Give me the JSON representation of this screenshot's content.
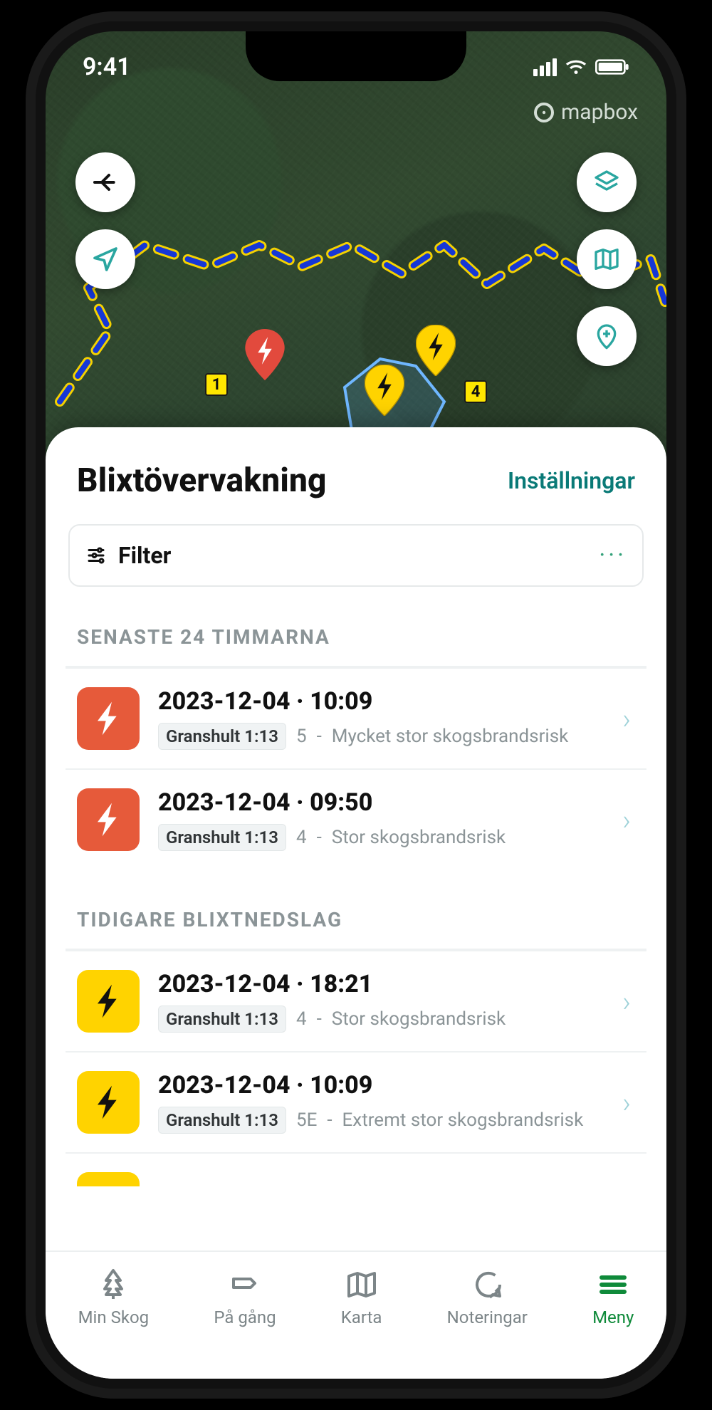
{
  "status": {
    "time": "9:41"
  },
  "map": {
    "attribution": "mapbox",
    "parcel_labels": [
      "1",
      "4"
    ]
  },
  "sheet": {
    "title": "Blixtövervakning",
    "settings_label": "Inställningar",
    "filter_label": "Filter"
  },
  "sections": {
    "recent_title": "SENASTE 24 TIMMARNA",
    "earlier_title": "TIDIGARE BLIXTNEDSLAG"
  },
  "events_recent": [
    {
      "title": "2023-12-04 · 10:09",
      "chip": "Granshult 1:13",
      "level": "5",
      "risk": "Mycket stor skogsbrandsrisk",
      "severity": "red"
    },
    {
      "title": "2023-12-04 · 09:50",
      "chip": "Granshult 1:13",
      "level": "4",
      "risk": "Stor skogsbrandsrisk",
      "severity": "red"
    }
  ],
  "events_earlier": [
    {
      "title": "2023-12-04 · 18:21",
      "chip": "Granshult 1:13",
      "level": "4",
      "risk": "Stor skogsbrandsrisk",
      "severity": "yellow"
    },
    {
      "title": "2023-12-04 · 10:09",
      "chip": "Granshult 1:13",
      "level": "5E",
      "risk": "Extremt stor skogsbrandsrisk",
      "severity": "yellow"
    }
  ],
  "tabs": [
    {
      "label": "Min Skog"
    },
    {
      "label": "På gång"
    },
    {
      "label": "Karta"
    },
    {
      "label": "Noteringar"
    },
    {
      "label": "Meny"
    }
  ]
}
